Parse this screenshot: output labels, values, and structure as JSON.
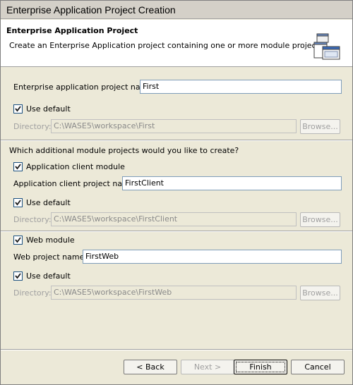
{
  "window": {
    "title": "Enterprise Application Project Creation"
  },
  "header": {
    "title": "Enterprise Application Project",
    "description": "Create an Enterprise Application project containing one or more module projects.",
    "icon": "project-windows-icon"
  },
  "ear": {
    "name_label": "Enterprise application project name:",
    "name_value": "First",
    "use_default_label": "Use default",
    "use_default_checked": true,
    "directory_label": "Directory:",
    "directory_value": "C:\\WASE5\\workspace\\First",
    "browse_label": "Browse..."
  },
  "modules_question": "Which additional module projects would you like to create?",
  "client": {
    "module_label": "Application client module",
    "module_checked": true,
    "name_label": "Application client project name:",
    "name_value": "FirstClient",
    "use_default_label": "Use default",
    "use_default_checked": true,
    "directory_label": "Directory:",
    "directory_value": "C:\\WASE5\\workspace\\FirstClient",
    "browse_label": "Browse..."
  },
  "web": {
    "module_label": "Web module",
    "module_checked": true,
    "name_label": "Web project name:",
    "name_value": "FirstWeb",
    "use_default_label": "Use default",
    "use_default_checked": true,
    "directory_label": "Directory:",
    "directory_value": "C:\\WASE5\\workspace\\FirstWeb",
    "browse_label": "Browse..."
  },
  "buttons": {
    "back": "< Back",
    "next": "Next >",
    "finish": "Finish",
    "cancel": "Cancel"
  }
}
